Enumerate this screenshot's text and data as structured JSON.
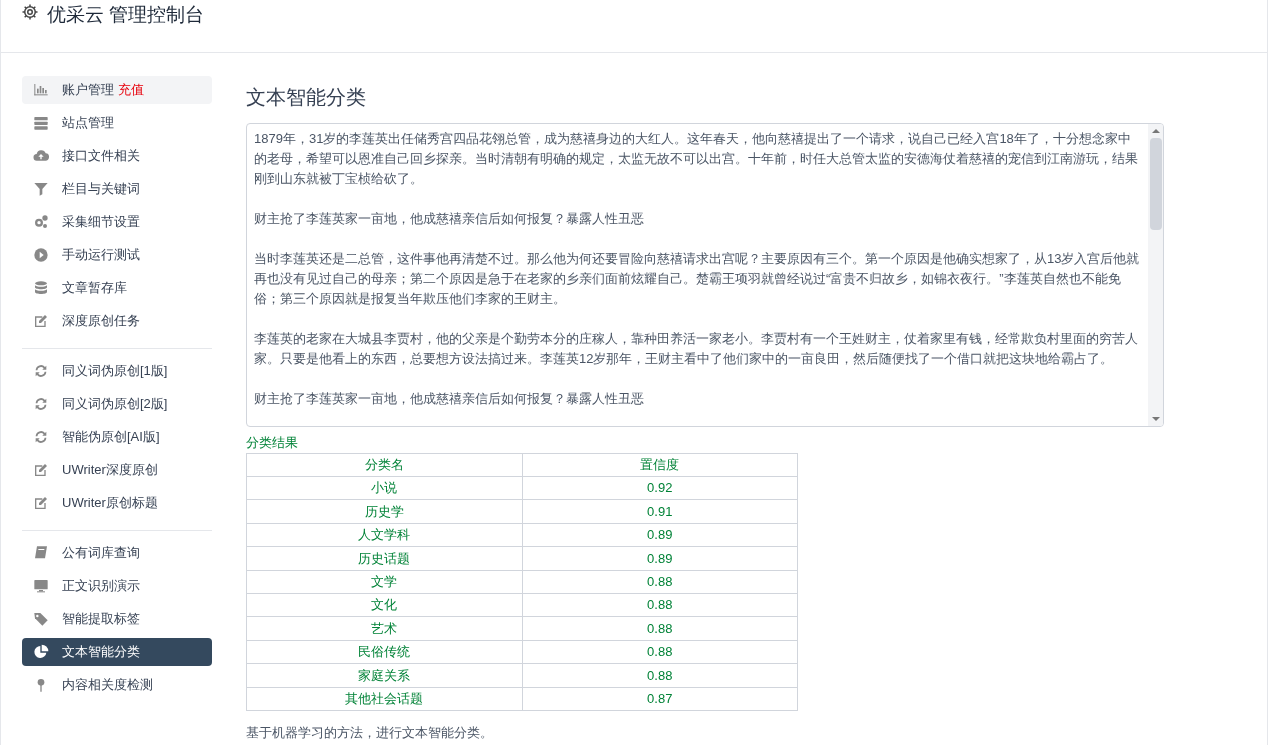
{
  "header": {
    "title": "优采云 管理控制台"
  },
  "sidebar": {
    "groups": [
      {
        "items": [
          {
            "label": "账户管理",
            "badge": "充值",
            "selected": false,
            "hovered": true
          },
          {
            "label": "站点管理",
            "selected": false,
            "hovered": false
          },
          {
            "label": "接口文件相关",
            "selected": false,
            "hovered": false
          },
          {
            "label": "栏目与关键词",
            "selected": false,
            "hovered": false
          },
          {
            "label": "采集细节设置",
            "selected": false,
            "hovered": false
          },
          {
            "label": "手动运行测试",
            "selected": false,
            "hovered": false
          },
          {
            "label": "文章暂存库",
            "selected": false,
            "hovered": false
          },
          {
            "label": "深度原创任务",
            "selected": false,
            "hovered": false
          }
        ]
      },
      {
        "items": [
          {
            "label": "同义词伪原创[1版]",
            "selected": false,
            "hovered": false
          },
          {
            "label": "同义词伪原创[2版]",
            "selected": false,
            "hovered": false
          },
          {
            "label": "智能伪原创[AI版]",
            "selected": false,
            "hovered": false
          },
          {
            "label": "UWriter深度原创",
            "selected": false,
            "hovered": false
          },
          {
            "label": "UWriter原创标题",
            "selected": false,
            "hovered": false
          }
        ]
      },
      {
        "items": [
          {
            "label": "公有词库查询",
            "selected": false,
            "hovered": false
          },
          {
            "label": "正文识别演示",
            "selected": false,
            "hovered": false
          },
          {
            "label": "智能提取标签",
            "selected": false,
            "hovered": false
          },
          {
            "label": "文本智能分类",
            "selected": true,
            "hovered": false
          },
          {
            "label": "内容相关度检测",
            "selected": false,
            "hovered": false
          }
        ]
      }
    ]
  },
  "main": {
    "title": "文本智能分类",
    "text_input": {
      "paragraphs": [
        "1879年，31岁的李莲英出任储秀宫四品花翎总管，成为慈禧身边的大红人。这年春天，他向慈禧提出了一个请求，说自己已经入宫18年了，十分想念家中的老母，希望可以恩准自己回乡探亲。当时清朝有明确的规定，太监无故不可以出宫。十年前，时任大总管太监的安德海仗着慈禧的宠信到江南游玩，结果刚到山东就被丁宝桢给砍了。",
        "财主抢了李莲英家一亩地，他成慈禧亲信后如何报复？暴露人性丑恶",
        "当时李莲英还是二总管，这件事他再清楚不过。那么他为何还要冒险向慈禧请求出宫呢？主要原因有三个。第一个原因是他确实想家了，从13岁入宫后他就再也没有见过自己的母亲；第二个原因是急于在老家的乡亲们面前炫耀自己。楚霸王项羽就曾经说过“富贵不归故乡，如锦衣夜行。”李莲英自然也不能免俗；第三个原因就是报复当年欺压他们李家的王财主。",
        "李莲英的老家在大城县李贾村，他的父亲是个勤劳本分的庄稼人，靠种田养活一家老小。李贾村有一个王姓财主，仗着家里有钱，经常欺负村里面的穷苦人家。只要是他看上的东西，总要想方设法搞过来。李莲英12岁那年，王财主看中了他们家中的一亩良田，然后随便找了一个借口就把这块地给霸占了。",
        "财主抢了李莲英家一亩地，他成慈禧亲信后如何报复？暴露人性丑恶"
      ]
    },
    "result": {
      "heading": "分类结果",
      "columns": [
        "分类名",
        "置信度"
      ],
      "rows": [
        [
          "小说",
          "0.92"
        ],
        [
          "历史学",
          "0.91"
        ],
        [
          "人文学科",
          "0.89"
        ],
        [
          "历史话题",
          "0.89"
        ],
        [
          "文学",
          "0.88"
        ],
        [
          "文化",
          "0.88"
        ],
        [
          "艺术",
          "0.88"
        ],
        [
          "民俗传统",
          "0.88"
        ],
        [
          "家庭关系",
          "0.88"
        ],
        [
          "其他社会话题",
          "0.87"
        ]
      ]
    },
    "footnote": "基于机器学习的方法，进行文本智能分类。"
  }
}
